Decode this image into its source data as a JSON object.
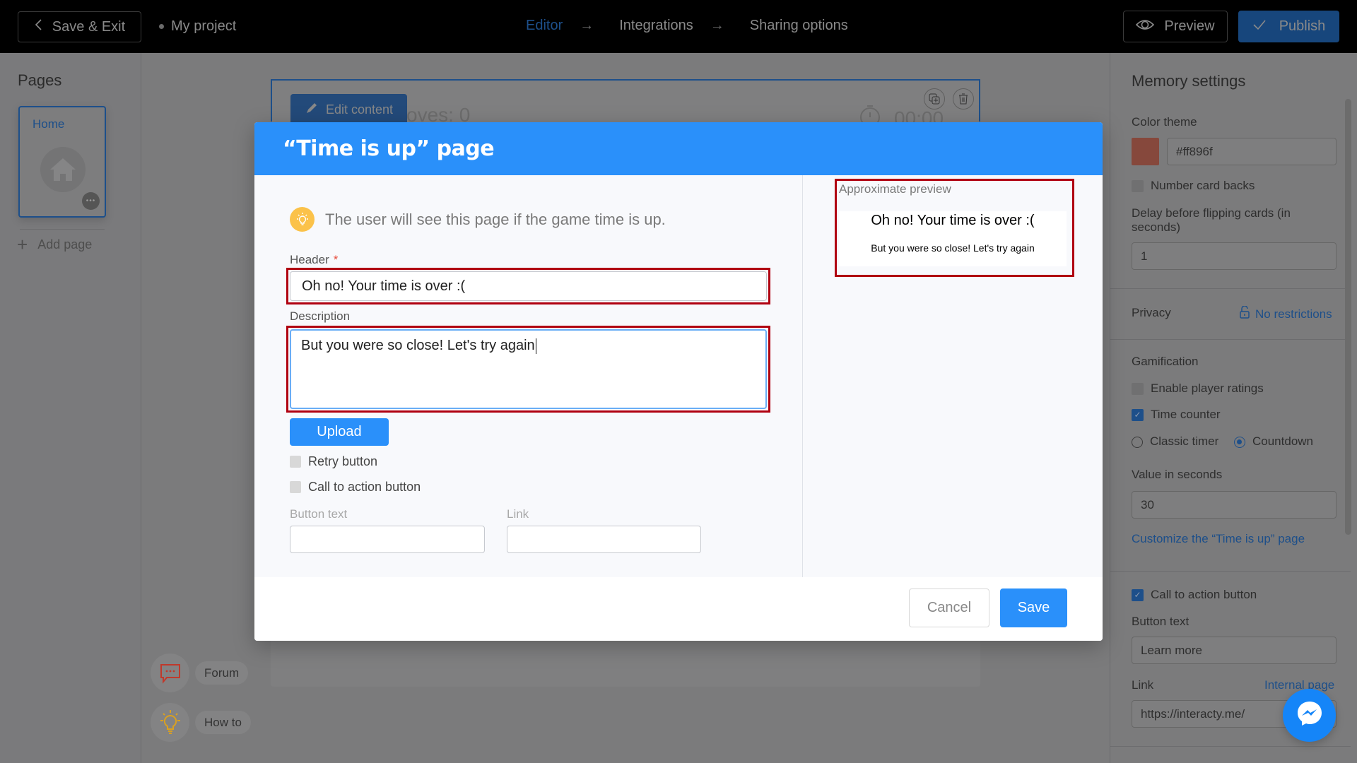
{
  "topbar": {
    "save_exit_label": "Save & Exit",
    "project_name": "My project",
    "steps": [
      "Editor",
      "Integrations",
      "Sharing options"
    ],
    "active_step": "Editor",
    "preview_label": "Preview",
    "publish_label": "Publish"
  },
  "pages_panel": {
    "title": "Pages",
    "pages": [
      {
        "label": "Home"
      }
    ],
    "add_page_label": "Add page"
  },
  "canvas": {
    "edit_content_label": "Edit content",
    "moves_text": "oves: 0",
    "timer_text": "00:00"
  },
  "help": {
    "forum_label": "Forum",
    "howto_label": "How to"
  },
  "settings": {
    "title": "Memory settings",
    "color_theme_label": "Color theme",
    "color_value": "#ff896f",
    "number_card_backs_label": "Number card backs",
    "number_card_backs_checked": false,
    "delay_label": "Delay before flipping cards (in seconds)",
    "delay_value": "1",
    "privacy_label": "Privacy",
    "privacy_value": "No restrictions",
    "gamification_label": "Gamification",
    "enable_ratings_label": "Enable player ratings",
    "enable_ratings_checked": false,
    "time_counter_label": "Time counter",
    "time_counter_checked": true,
    "timer_options": [
      "Classic timer",
      "Countdown"
    ],
    "timer_selected": "Countdown",
    "value_seconds_label": "Value in seconds",
    "value_seconds": "30",
    "customize_link": "Customize the “Time is up” page",
    "cta_label": "Call to action button",
    "cta_checked": true,
    "button_text_label": "Button text",
    "button_text_value": "Learn more",
    "link_label": "Link",
    "internal_page_link": "Internal page",
    "link_value": "https://interacty.me/"
  },
  "modal": {
    "title": "“Time is up” page",
    "hint": "The user will see this page if the game time is up.",
    "header_label": "Header",
    "header_required_mark": "*",
    "header_value": "Oh no! Your time is over :(",
    "description_label": "Description",
    "description_value": "But you were so close! Let's try again",
    "upload_label": "Upload",
    "retry_label": "Retry button",
    "retry_checked": false,
    "cta_label": "Call to action button",
    "cta_checked": false,
    "button_text_label": "Button text",
    "button_text_value": "",
    "link_label": "Link",
    "link_value": "",
    "preview_label": "Approximate preview",
    "preview_header": "Oh no! Your time is over :(",
    "preview_description": "But you were so close! Let's try again",
    "cancel_label": "Cancel",
    "save_label": "Save"
  },
  "colors": {
    "accent": "#2a90fa",
    "topbar_bg": "#000000",
    "highlight_red": "#b00010",
    "bulb_yellow": "#fbc24a",
    "messenger_blue": "#1585f8"
  }
}
